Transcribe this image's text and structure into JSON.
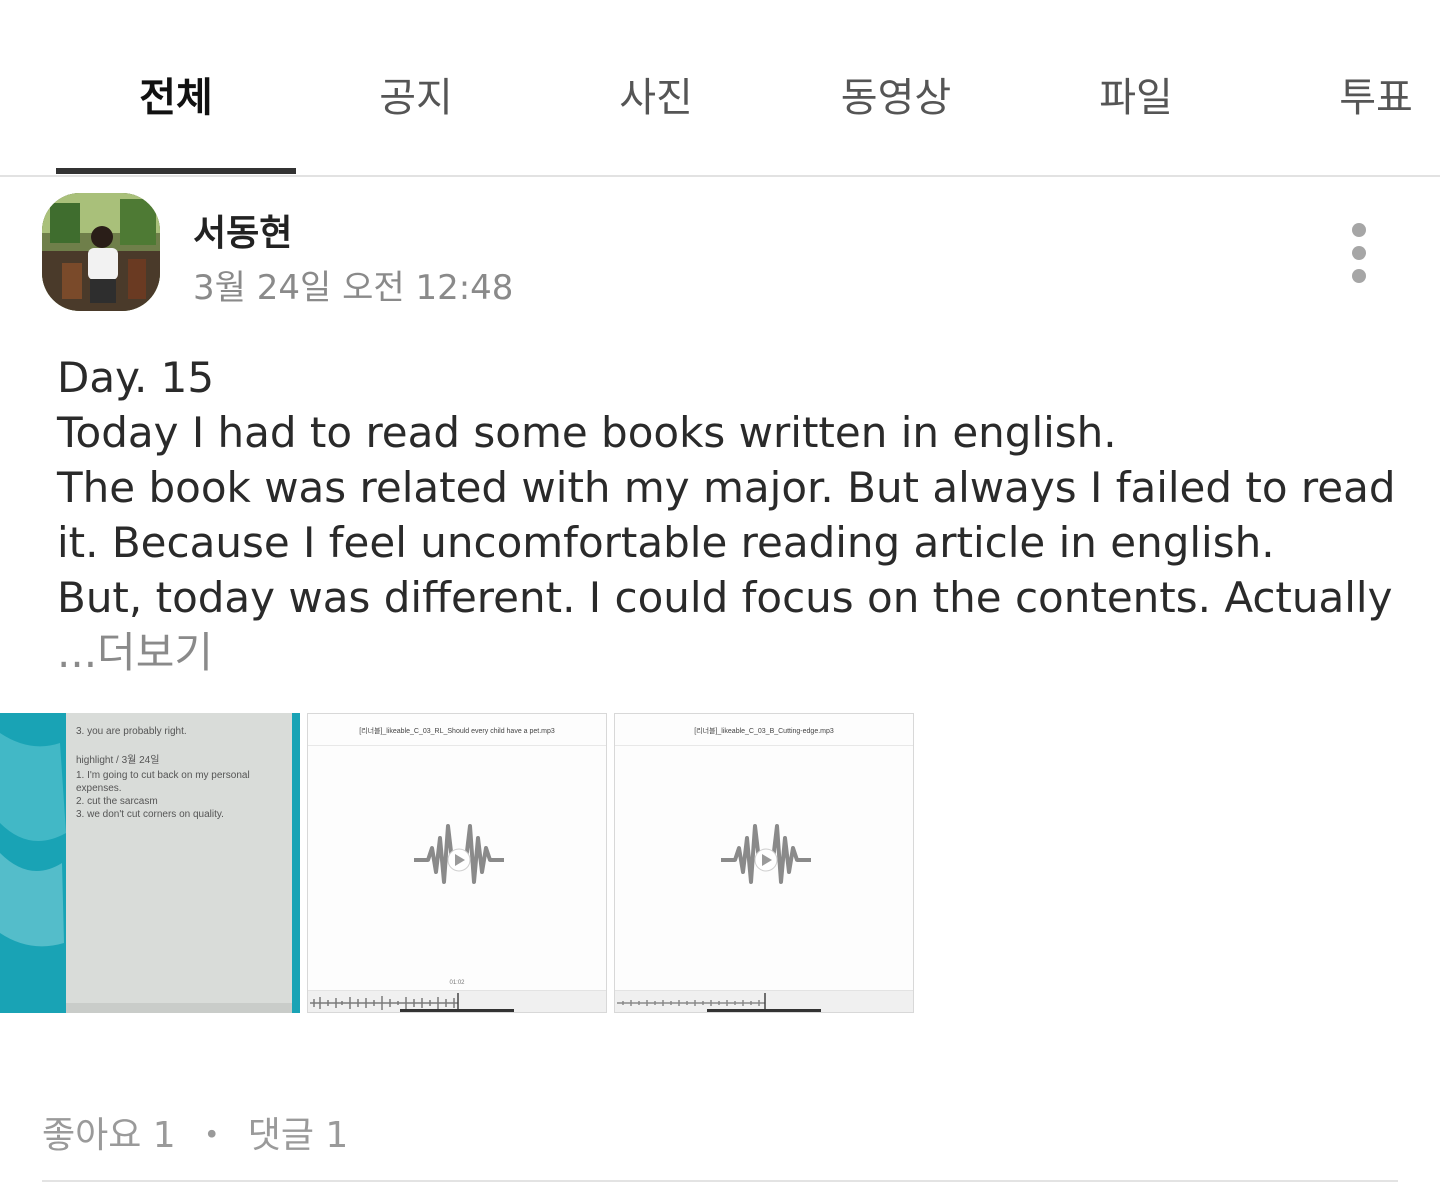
{
  "tabs": [
    {
      "label": "전체",
      "active": true
    },
    {
      "label": "공지",
      "active": false
    },
    {
      "label": "사진",
      "active": false
    },
    {
      "label": "동영상",
      "active": false
    },
    {
      "label": "파일",
      "active": false
    },
    {
      "label": "투표",
      "active": false
    }
  ],
  "post": {
    "author": "서동현",
    "timestamp": "3월 24일 오전 12:48",
    "lines": [
      "Day. 15",
      "Today I had to read some books written in english.",
      "The book was related with my major. But always I failed to read",
      "it. Because I feel uncomfortable reading article in english.",
      "But, today was different. I could focus on the contents. Actually"
    ],
    "more_label": "...더보기",
    "attachments": {
      "photo": {
        "lines": [
          "3. you are probably right.",
          "highlight / 3월 24일",
          "1. I'm going to cut back on my personal",
          "expenses.",
          "2. cut the sarcasm",
          "3. we don't cut corners on quality."
        ]
      },
      "audio": [
        {
          "title": "[리너블]_likeable_C_03_RL_Should every child have a pet.mp3",
          "time": "01:02"
        },
        {
          "title": "[리너블]_likeable_C_03_B_Cutting-edge.mp3",
          "time": ""
        }
      ]
    },
    "reactions": {
      "likes": "좋아요 1",
      "separator": "・",
      "comments": "댓글 1"
    }
  },
  "icons": {
    "more": "more-vertical-icon",
    "audio": "audio-waveform-play-icon"
  },
  "colors": {
    "tab_indicator": "#333333",
    "muted_text": "#8a8a8a",
    "photo_bg": "#1aa6b8"
  }
}
